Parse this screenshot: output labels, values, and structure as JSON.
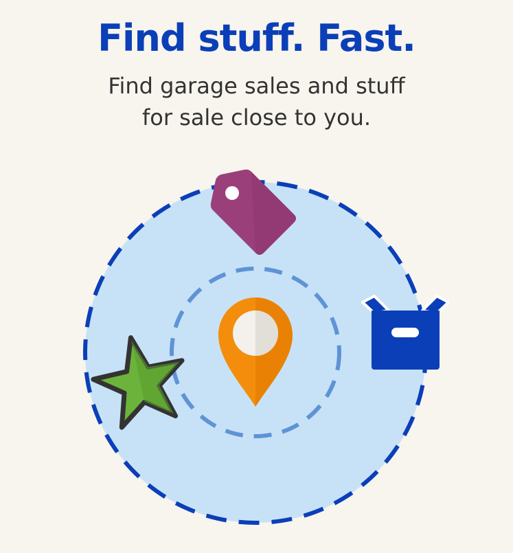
{
  "hero": {
    "headline": "Find stuff. Fast.",
    "subline_1": "Find garage sales and stuff",
    "subline_2": "for sale close to you."
  },
  "colors": {
    "background": "#f8f4ee",
    "headline": "#0b3fb8",
    "outer_circle_fill": "#c7e2f6",
    "outer_ring_dash": "#0b3fb8",
    "inner_ring_dash": "#5f93d6",
    "tag": "#9b3f7a",
    "box": "#0b3fb8",
    "pin": "#f48d0b",
    "star": "#6cb33b"
  },
  "icons": [
    "price-tag-icon",
    "box-icon",
    "location-pin-icon",
    "star-icon"
  ]
}
